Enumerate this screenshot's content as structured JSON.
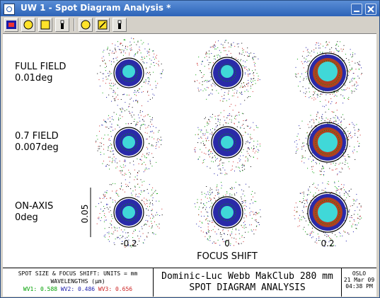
{
  "window": {
    "title": "UW 1 - Spot Diagram Analysis *"
  },
  "toolbar": {
    "items": [
      "spot-grid-tool",
      "circle-tool",
      "square-tool",
      "bar-tool",
      "circle-tool-2",
      "pen-tool",
      "bar-tool-2"
    ]
  },
  "plot": {
    "field_labels": [
      {
        "name": "FULL FIELD",
        "value": "0.01deg"
      },
      {
        "name": "0.7 FIELD",
        "value": "0.007deg"
      },
      {
        "name": "ON-AXIS",
        "value": "0deg"
      }
    ],
    "scale_label": "0.05",
    "focus_ticks": [
      "-0.2",
      "0",
      "0.2"
    ],
    "xaxis_label": "FOCUS SHIFT"
  },
  "footer": {
    "units": "SPOT SIZE & FOCUS SHIFT: UNITS = mm",
    "wavelengths_label": "WAVELENGTHS (µm)",
    "wl1": "WV1: 0.588",
    "wl2": "WV2: 0.486",
    "wl3": "WV3: 0.656",
    "title": "Dominic-Luc Webb MakClub 280 mm",
    "subtitle": "SPOT DIAGRAM ANALYSIS",
    "program": "OSLO",
    "date": "21 Mar 09",
    "time": "04:38 PM"
  },
  "colors": {
    "wl1": "#00a000",
    "wl2": "#1a1aaa",
    "wl3": "#cc2222",
    "core": "#40d8d8",
    "ring_blue": "#2a2aa8",
    "ring_red": "#b04020",
    "titlebar": "#2d63b8"
  }
}
